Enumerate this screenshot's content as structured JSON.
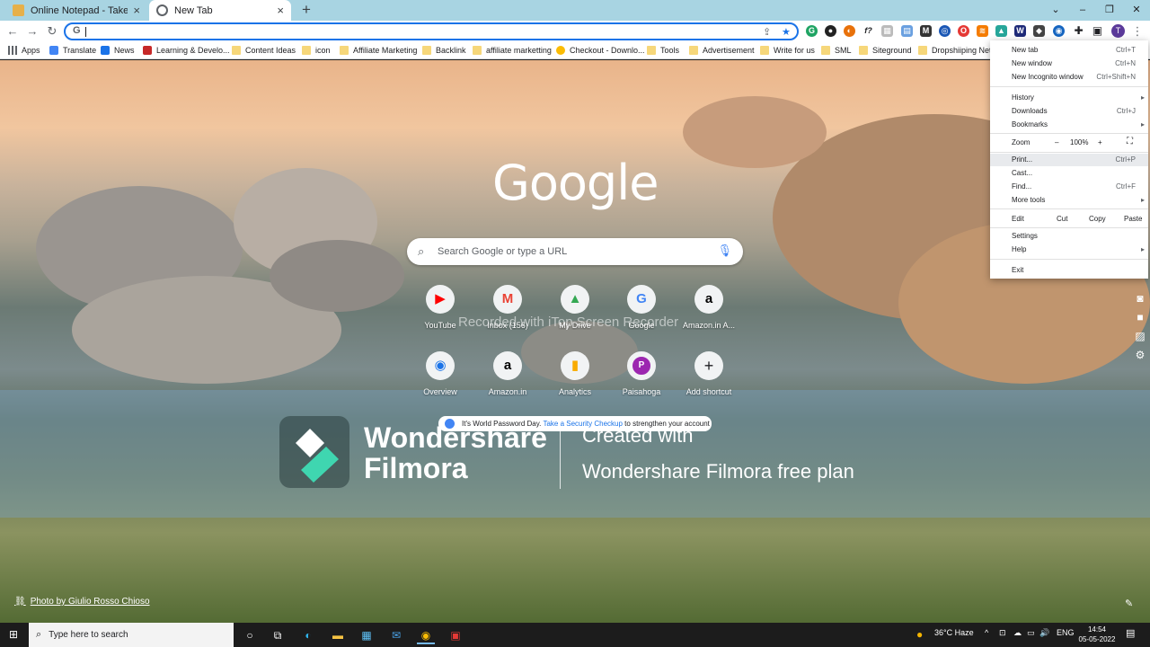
{
  "tabs": [
    {
      "label": "Online Notepad - Take Notes and",
      "favicon": "notepad-icon",
      "active": false
    },
    {
      "label": "New Tab",
      "favicon": "chrome-icon",
      "active": true
    }
  ],
  "window_controls": {
    "minimize": "–",
    "maximize": "❐",
    "close": "✕",
    "dropdown": "⌄"
  },
  "omnibox": {
    "value": "",
    "prefix": "G"
  },
  "bookmarks": [
    {
      "label": "Apps",
      "icon": "apps-grid-icon"
    },
    {
      "label": "Translate",
      "icon": "translate-icon"
    },
    {
      "label": "News",
      "icon": "news-icon"
    },
    {
      "label": "Learning & Develo...",
      "icon": "learning-icon"
    },
    {
      "label": "Content Ideas",
      "icon": "folder-icon"
    },
    {
      "label": "icon",
      "icon": "folder-icon"
    },
    {
      "label": "Affiliate Marketing",
      "icon": "folder-icon"
    },
    {
      "label": "Backlink",
      "icon": "folder-icon"
    },
    {
      "label": "affiliate marketting",
      "icon": "folder-icon"
    },
    {
      "label": "Checkout - Downlo...",
      "icon": "checkout-icon"
    },
    {
      "label": "Tools",
      "icon": "folder-icon"
    },
    {
      "label": "Advertisement",
      "icon": "folder-icon"
    },
    {
      "label": "Write for us",
      "icon": "folder-icon"
    },
    {
      "label": "SML",
      "icon": "folder-icon"
    },
    {
      "label": "Siteground",
      "icon": "folder-icon"
    },
    {
      "label": "Dropshiiping Netw",
      "icon": "folder-icon"
    }
  ],
  "google_logo": "Google",
  "search": {
    "placeholder": "Search Google or type a URL"
  },
  "shortcuts_row1": [
    {
      "label": "YouTube",
      "glyph": "▶",
      "color": "#ff0000"
    },
    {
      "label": "Inbox (156)",
      "glyph": "M",
      "color": "#ea4335"
    },
    {
      "label": "My Drive",
      "glyph": "▲",
      "color": "#34a853"
    },
    {
      "label": "Google",
      "glyph": "G",
      "color": "#4285f4"
    },
    {
      "label": "Amazon.in A...",
      "glyph": "a",
      "color": "#000000"
    }
  ],
  "shortcuts_row2": [
    {
      "label": "Overview",
      "glyph": "◉",
      "color": "#1a73e8"
    },
    {
      "label": "Amazon.in",
      "glyph": "a",
      "color": "#000000"
    },
    {
      "label": "Analytics",
      "glyph": "▮",
      "color": "#f9ab00"
    },
    {
      "label": "Paisahoga",
      "glyph": "P",
      "color": "#9c27b0"
    },
    {
      "label": "Add shortcut",
      "glyph": "+",
      "color": "#202124"
    }
  ],
  "watermark": "Recorded with iTop Screen Recorder",
  "password_notice": {
    "before": "It's World Password Day. ",
    "link": "Take a Security Checkup",
    "after": " to strengthen your account"
  },
  "filmora": {
    "brand_line1": "Wondershare",
    "brand_line2": "Filmora",
    "created": "Created with",
    "plan": "Wondershare Filmora free plan"
  },
  "photo_credit": "Photo by Giulio Rosso Chioso",
  "menu": {
    "items": [
      {
        "label": "New tab",
        "shortcut": "Ctrl+T"
      },
      {
        "label": "New window",
        "shortcut": "Ctrl+N"
      },
      {
        "label": "New Incognito window",
        "shortcut": "Ctrl+Shift+N"
      },
      {
        "label": "History",
        "shortcut": "",
        "submenu": true
      },
      {
        "label": "Downloads",
        "shortcut": "Ctrl+J"
      },
      {
        "label": "Bookmarks",
        "shortcut": "",
        "submenu": true
      },
      {
        "label": "Print...",
        "shortcut": "Ctrl+P"
      },
      {
        "label": "Cast...",
        "shortcut": ""
      },
      {
        "label": "Find...",
        "shortcut": "Ctrl+F"
      },
      {
        "label": "More tools",
        "shortcut": "",
        "submenu": true
      },
      {
        "label": "Settings",
        "shortcut": ""
      },
      {
        "label": "Help",
        "shortcut": "",
        "submenu": true
      },
      {
        "label": "Exit",
        "shortcut": ""
      }
    ],
    "zoom": {
      "label": "Zoom",
      "minus": "–",
      "value": "100%",
      "plus": "+"
    },
    "edit": {
      "label": "Edit",
      "cut": "Cut",
      "copy": "Copy",
      "paste": "Paste"
    }
  },
  "taskbar": {
    "search_placeholder": "Type here to search",
    "weather": "36°C  Haze",
    "language": "ENG",
    "time": "14:54",
    "date": "05-05-2022"
  }
}
